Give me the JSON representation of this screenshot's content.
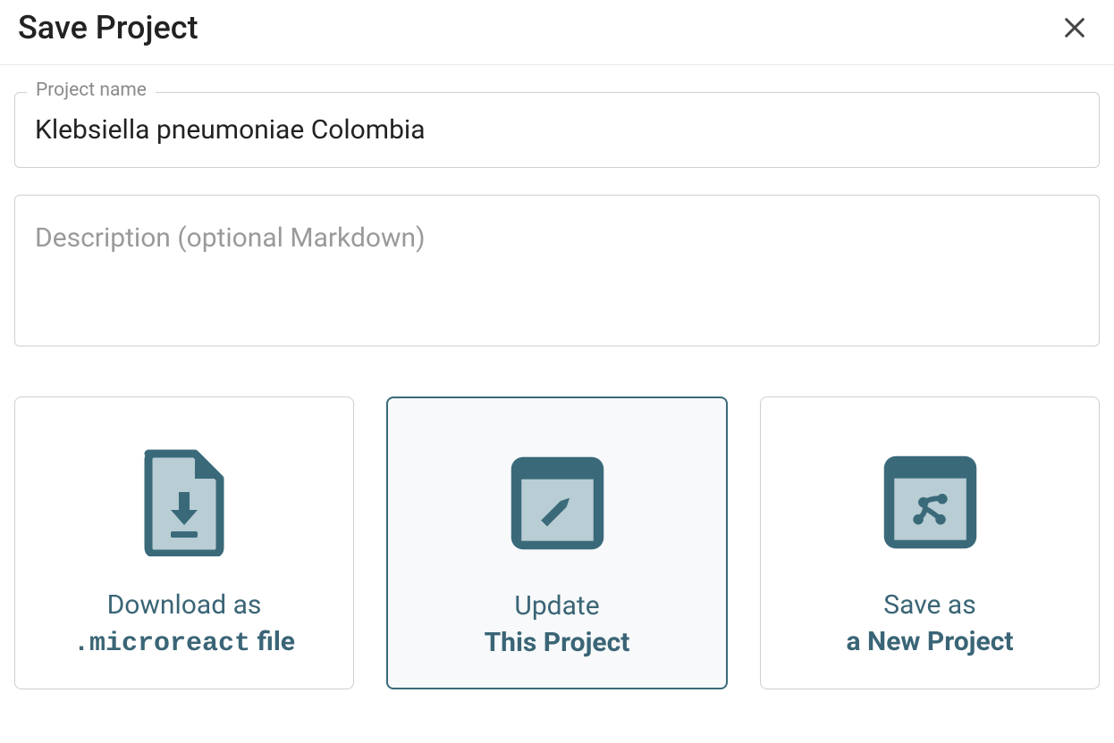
{
  "dialog": {
    "title": "Save Project",
    "close_label": "Close"
  },
  "fields": {
    "project_name": {
      "label": "Project name",
      "value": "Klebsiella pneumoniae Colombia"
    },
    "description": {
      "placeholder": "Description (optional Markdown)",
      "value": ""
    }
  },
  "actions": {
    "download": {
      "line1": "Download as",
      "line2_pre": ".microreact",
      "line2_post": " file"
    },
    "update": {
      "line1": "Update",
      "line2": "This Project"
    },
    "save_new": {
      "line1": "Save as",
      "line2": "a New Project"
    }
  }
}
